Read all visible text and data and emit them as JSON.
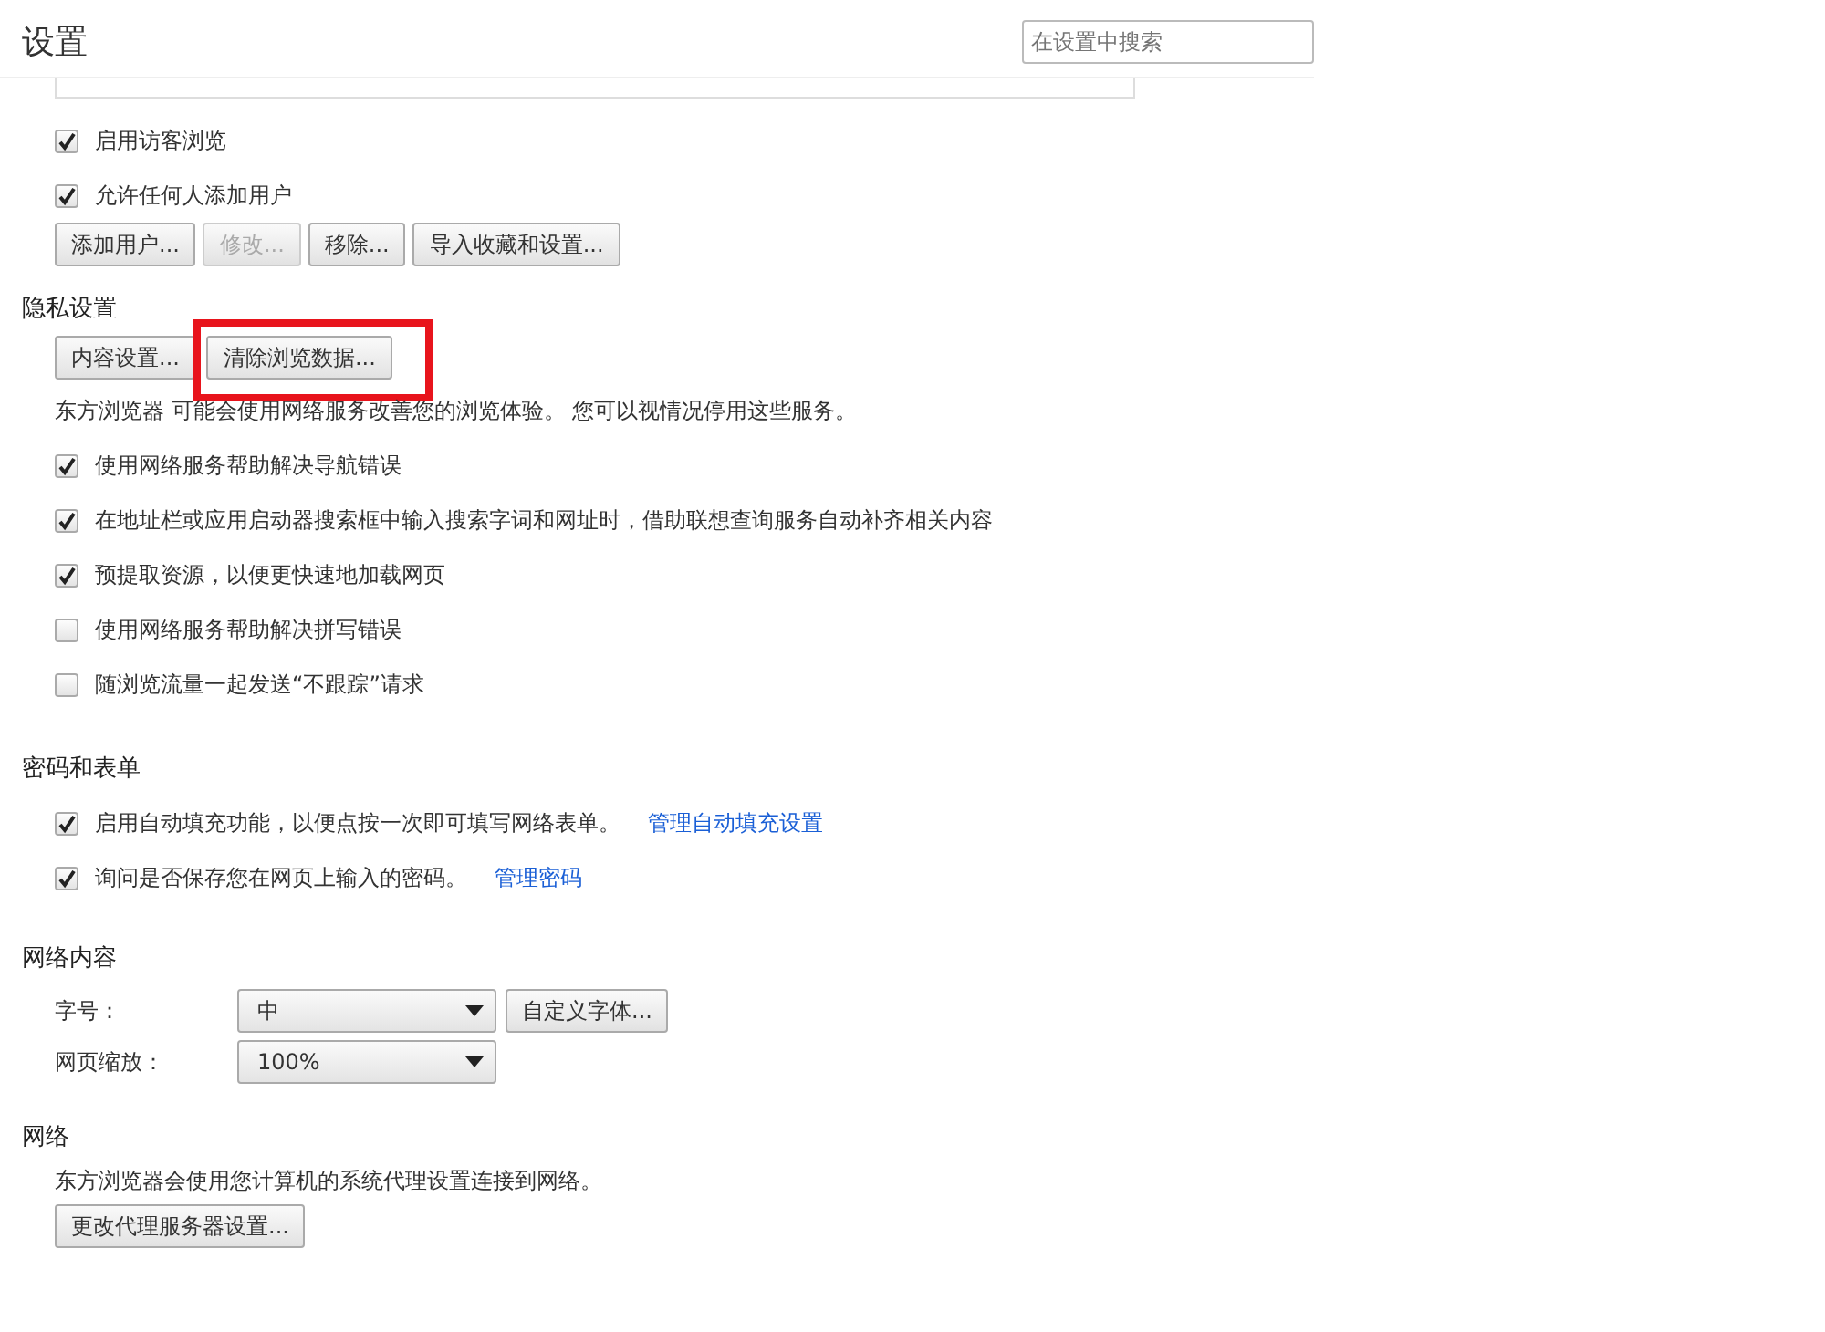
{
  "header": {
    "title": "设置",
    "search": {
      "placeholder": "在设置中搜索"
    }
  },
  "users": {
    "options": [
      {
        "label": "启用访客浏览",
        "checked": true
      },
      {
        "label": "允许任何人添加用户",
        "checked": true
      }
    ],
    "buttons": [
      {
        "label": "添加用户...",
        "disabled": false,
        "highlighted": false
      },
      {
        "label": "修改...",
        "disabled": true,
        "highlighted": false
      },
      {
        "label": "移除...",
        "disabled": false,
        "highlighted": false
      },
      {
        "label": "导入收藏和设置...",
        "disabled": false,
        "highlighted": false
      }
    ]
  },
  "privacy": {
    "heading": "隐私设置",
    "buttons": [
      {
        "label": "内容设置...",
        "disabled": false,
        "highlighted": false
      },
      {
        "label": "清除浏览数据...",
        "disabled": false,
        "highlighted": true
      }
    ],
    "description": "东方浏览器 可能会使用网络服务改善您的浏览体验。 您可以视情况停用这些服务。",
    "options": [
      {
        "label": "使用网络服务帮助解决导航错误",
        "checked": true
      },
      {
        "label": "在地址栏或应用启动器搜索框中输入搜索字词和网址时，借助联想查询服务自动补齐相关内容",
        "checked": true
      },
      {
        "label": "预提取资源，以便更快速地加载网页",
        "checked": true
      },
      {
        "label": "使用网络服务帮助解决拼写错误",
        "checked": false
      },
      {
        "label": "随浏览流量一起发送“不跟踪”请求",
        "checked": false
      }
    ]
  },
  "passwords": {
    "heading": "密码和表单",
    "options": [
      {
        "label": "启用自动填充功能，以便点按一次即可填写网络表单。",
        "checked": true,
        "link": "管理自动填充设置"
      },
      {
        "label": "询问是否保存您在网页上输入的密码。",
        "checked": true,
        "link": "管理密码"
      }
    ]
  },
  "web_content": {
    "heading": "网络内容",
    "rows": [
      {
        "label": "字号：",
        "value": "中",
        "button": "自定义字体..."
      },
      {
        "label": "网页缩放：",
        "value": "100%"
      }
    ]
  },
  "network": {
    "heading": "网络",
    "description": "东方浏览器会使用您计算机的系统代理设置连接到网络。",
    "button": "更改代理服务器设置..."
  }
}
